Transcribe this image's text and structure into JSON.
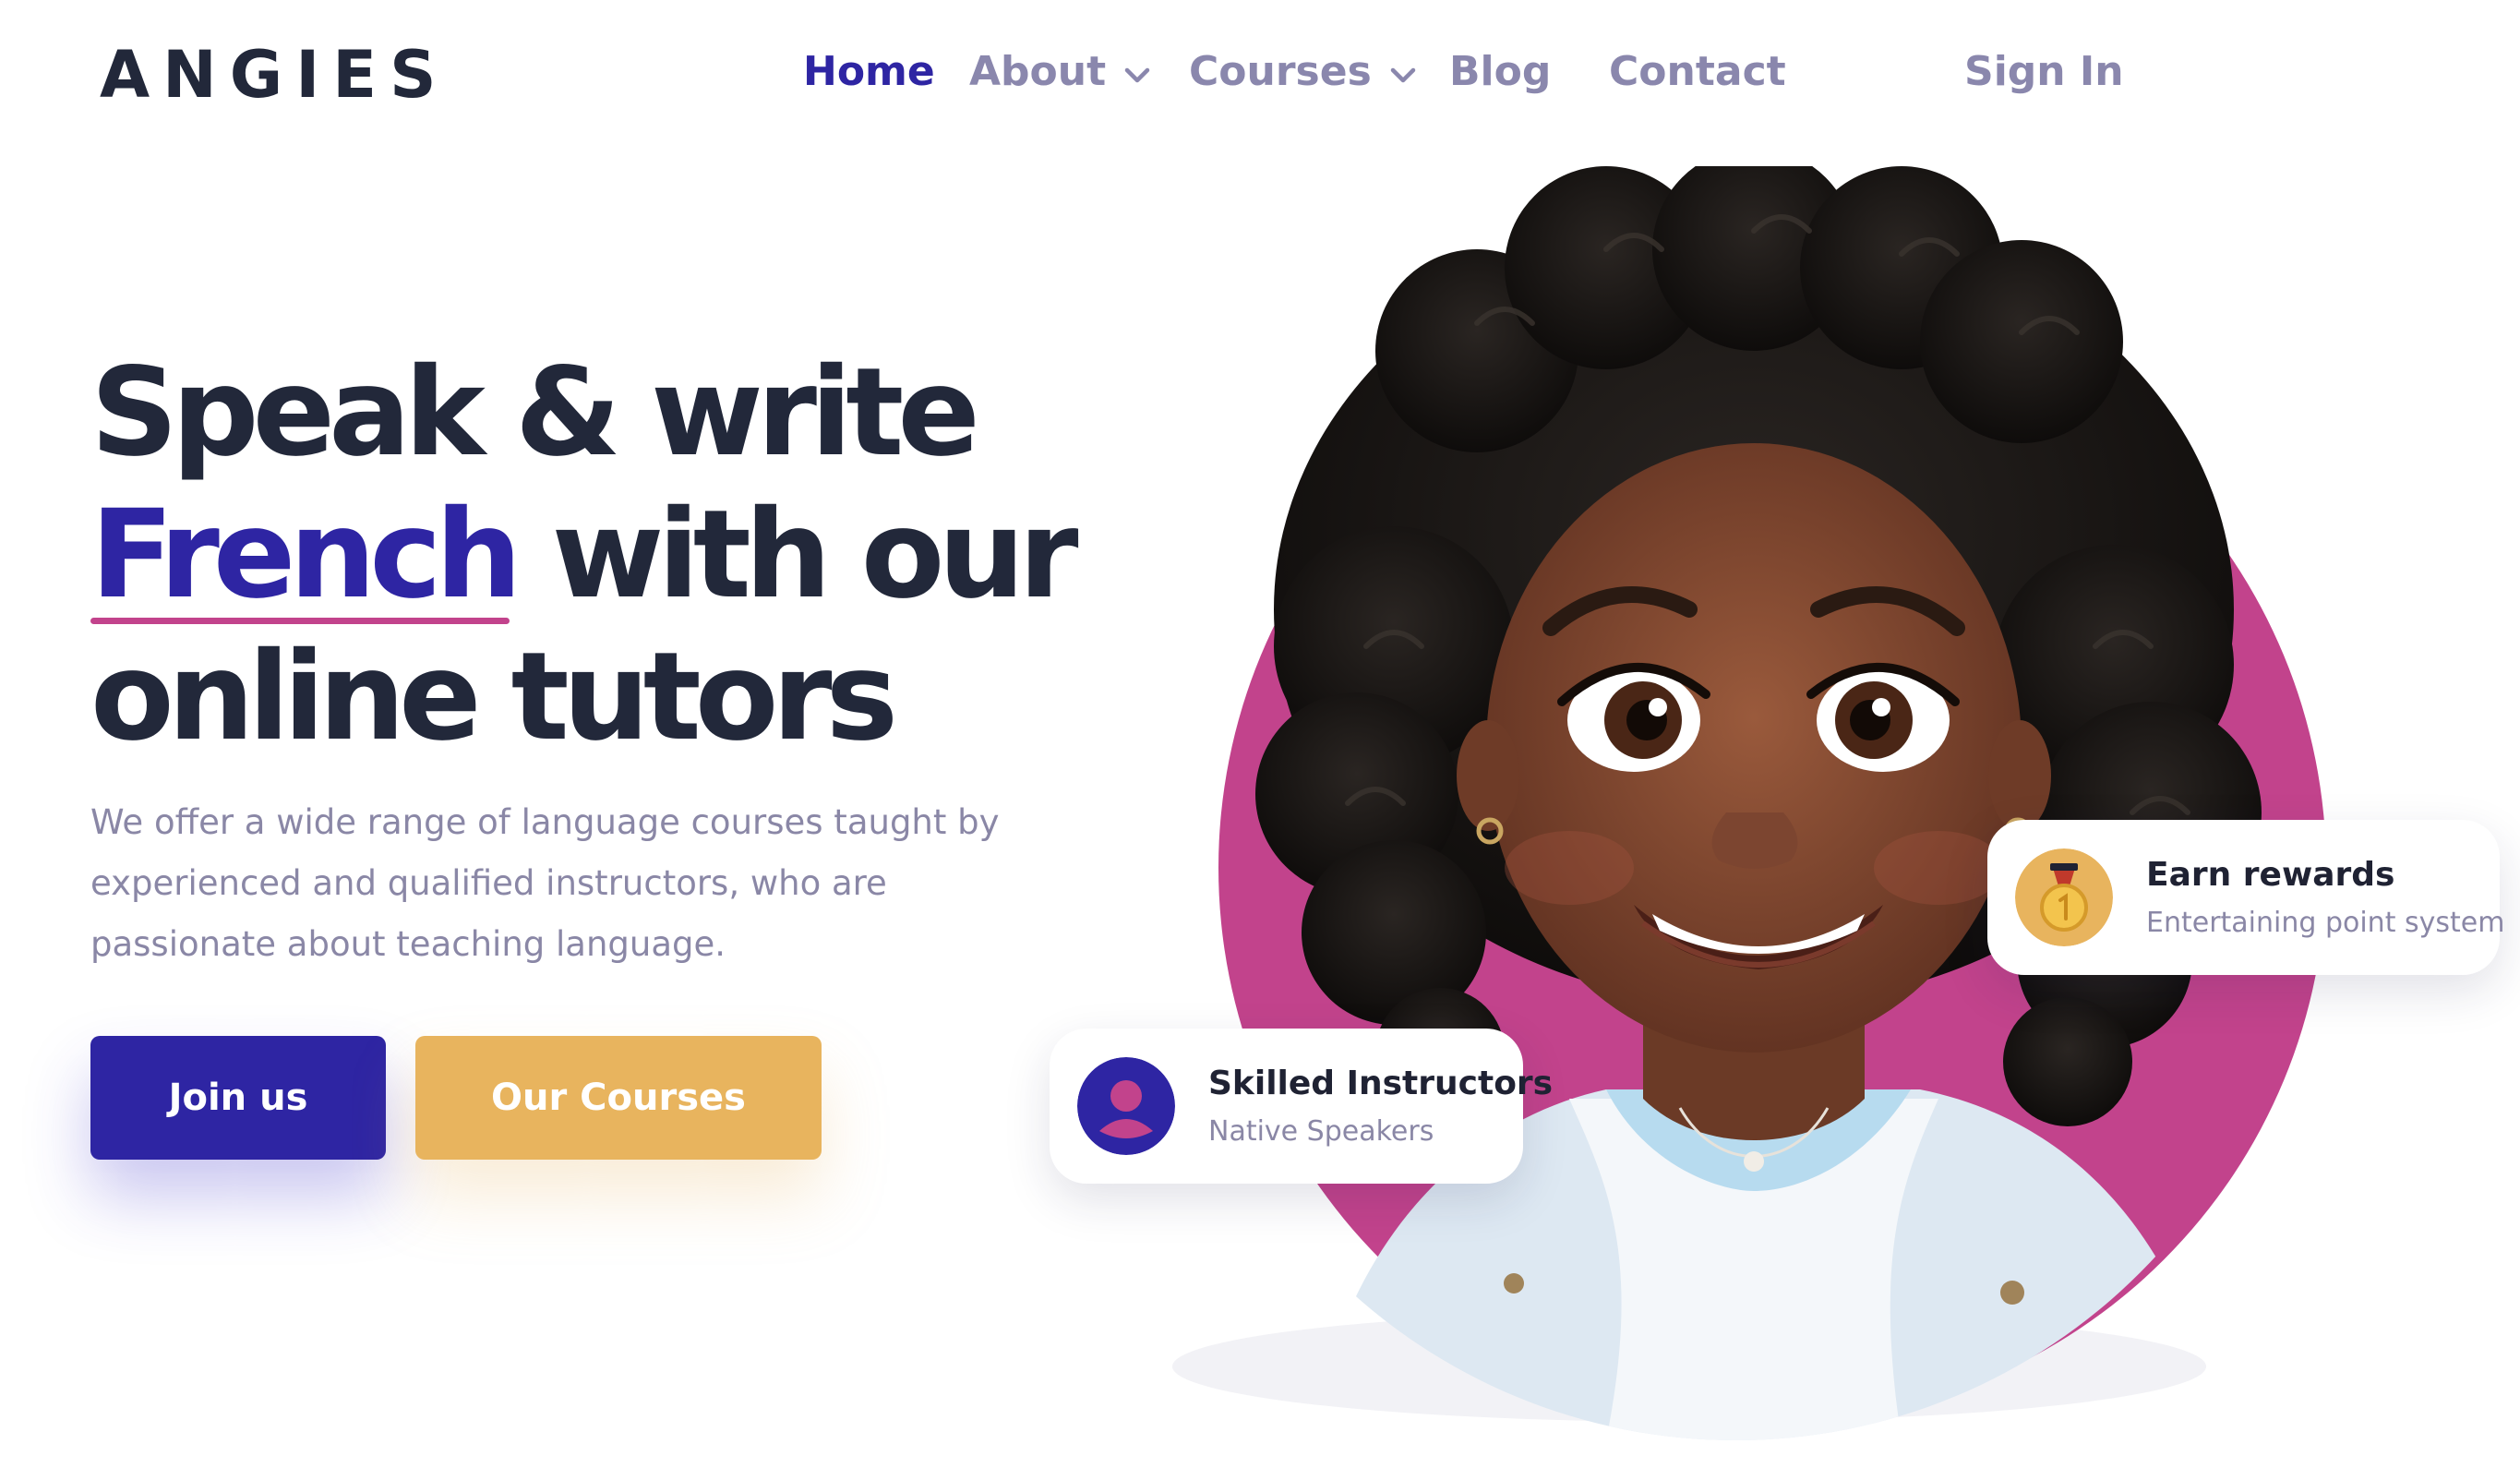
{
  "brand": {
    "logo": "ANGIES"
  },
  "nav": {
    "items": [
      {
        "label": "Home",
        "active": true,
        "has_dropdown": false
      },
      {
        "label": "About",
        "active": false,
        "has_dropdown": true
      },
      {
        "label": "Courses",
        "active": false,
        "has_dropdown": true
      },
      {
        "label": "Blog",
        "active": false,
        "has_dropdown": false
      },
      {
        "label": "Contact",
        "active": false,
        "has_dropdown": false
      }
    ],
    "sign_in": "Sign In"
  },
  "hero": {
    "headline_line1": "Speak & write",
    "headline_accent": "French",
    "headline_line2_rest": "with our",
    "headline_line3": "online tutors",
    "subtitle": "We offer a wide range of language courses taught by experienced and qualified instructors, who are passionate about teaching language.",
    "primary_button": "Join us",
    "secondary_button": "Our Courses"
  },
  "cards": {
    "instructors": {
      "title": "Skilled Instructors",
      "subtitle": "Native Speakers",
      "icon": "user-icon"
    },
    "rewards": {
      "title": "Earn rewards",
      "subtitle": "Entertaining point system",
      "icon": "medal-icon"
    }
  },
  "colors": {
    "primary": "#2e25a3",
    "accent_gold": "#e8b45e",
    "accent_pink": "#c2438c",
    "heading": "#22283a",
    "muted": "#8a87a6"
  }
}
